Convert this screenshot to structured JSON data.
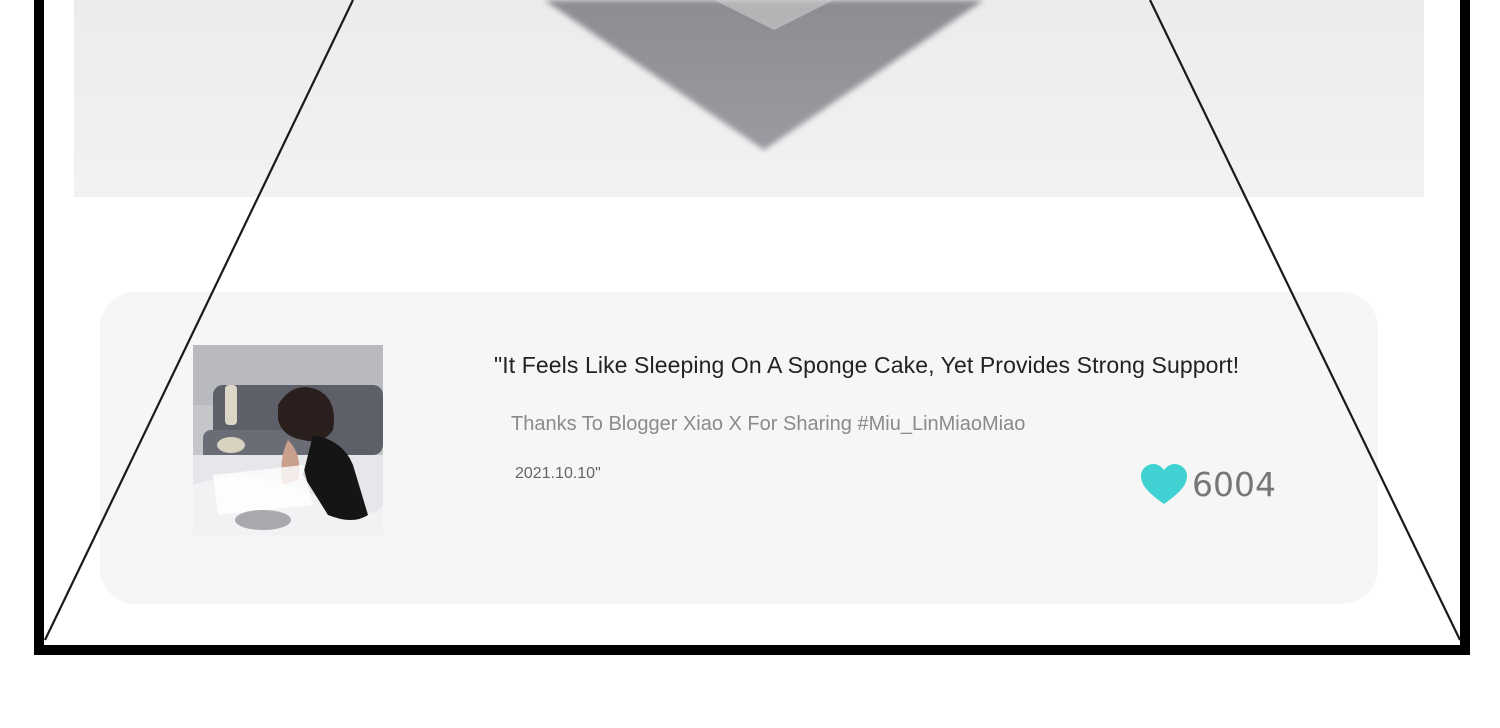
{
  "review": {
    "quote": "\"It Feels Like Sleeping On A Sponge Cake, Yet Provides Strong Support!",
    "credit": "Thanks To Blogger Xiao X For Sharing #Miu_LinMiaoMiao",
    "date": "2021.10.10\"",
    "likes": "6004"
  },
  "icons": {
    "like": "heart-icon"
  },
  "colors": {
    "heart": "#40d2d2",
    "card_background": "#f6f6f6",
    "frame_border": "#000000"
  }
}
